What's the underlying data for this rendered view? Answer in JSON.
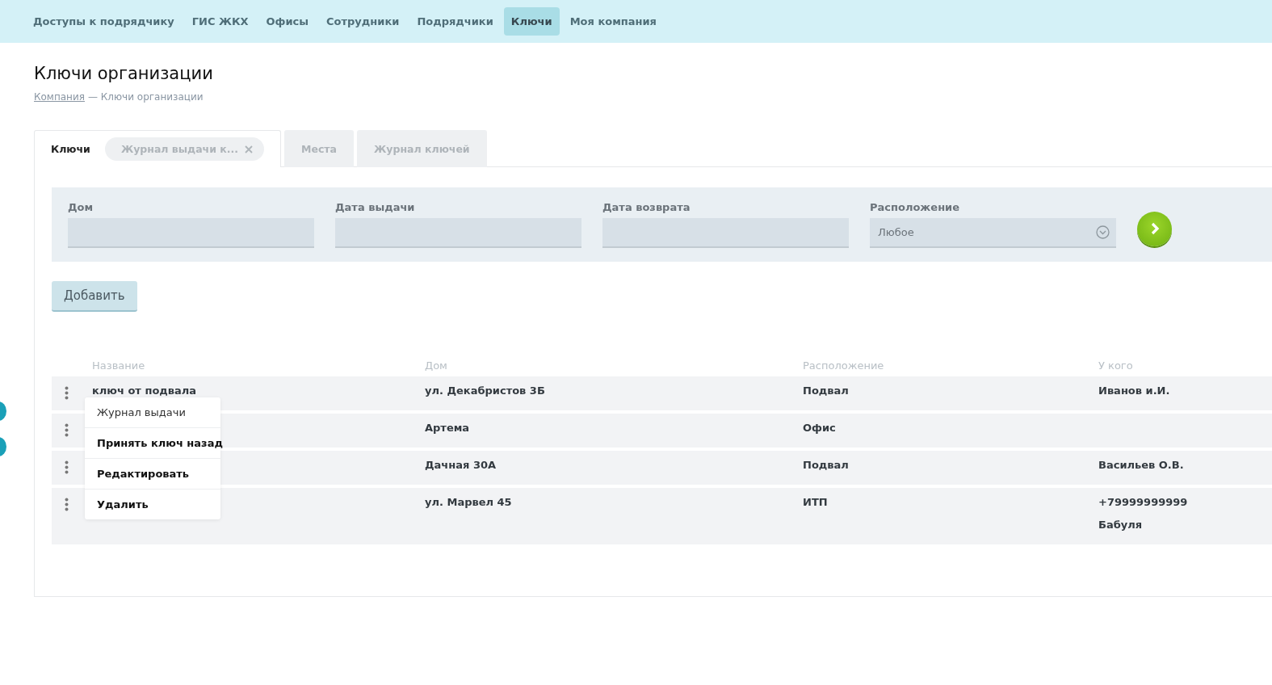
{
  "nav": [
    {
      "label": "Доступы к подрядчику",
      "selected": false
    },
    {
      "label": "ГИС ЖКХ",
      "selected": false
    },
    {
      "label": "Офисы",
      "selected": false
    },
    {
      "label": "Сотрудники",
      "selected": false
    },
    {
      "label": "Подрядчики",
      "selected": false
    },
    {
      "label": "Ключи",
      "selected": true
    },
    {
      "label": "Моя компания",
      "selected": false
    }
  ],
  "page_title": "Ключи организации",
  "breadcrumbs": {
    "link": "Компания",
    "current": "— Ключи организации"
  },
  "tabs": [
    {
      "label": "Ключи",
      "selected": true,
      "kind": "plain"
    },
    {
      "label": "Журнал выдачи к...",
      "selected": false,
      "kind": "closable"
    },
    {
      "label": "Места",
      "selected": false,
      "kind": "plain"
    },
    {
      "label": "Журнал ключей",
      "selected": false,
      "kind": "plain"
    }
  ],
  "filters": [
    {
      "label": "Дом",
      "kind": "text"
    },
    {
      "label": "Дата выдачи",
      "kind": "text"
    },
    {
      "label": "Дата возврата",
      "kind": "text"
    },
    {
      "label": "Расположение",
      "kind": "select",
      "value": "Любое"
    }
  ],
  "add_button": "Добавить",
  "table": {
    "columns": [
      "Название",
      "Дом",
      "Расположение",
      "У кого"
    ],
    "rows": [
      {
        "cells": [
          "ключ от подвала",
          "ул. Декабристов 3Б",
          "Подвал",
          "Иванов и.И."
        ]
      },
      {
        "cells": [
          "",
          "Артема",
          "Офис",
          ""
        ]
      },
      {
        "cells": [
          "",
          "Дачная 30А",
          "Подвал",
          "Васильев О.В."
        ]
      },
      {
        "cells": [
          "",
          "ул. Марвел 45",
          "ИТП",
          "+79999999999\nБабуля"
        ]
      }
    ]
  },
  "context_menu": [
    {
      "label": "Журнал выдачи",
      "selected": true
    },
    {
      "label": "Принять ключ назад",
      "selected": false
    },
    {
      "label": "Редактировать",
      "selected": false
    },
    {
      "label": "Удалить",
      "selected": false
    }
  ],
  "side_badges": [
    {
      "color": "#1aa0b8"
    },
    {
      "color": "#1aa0b8"
    }
  ]
}
